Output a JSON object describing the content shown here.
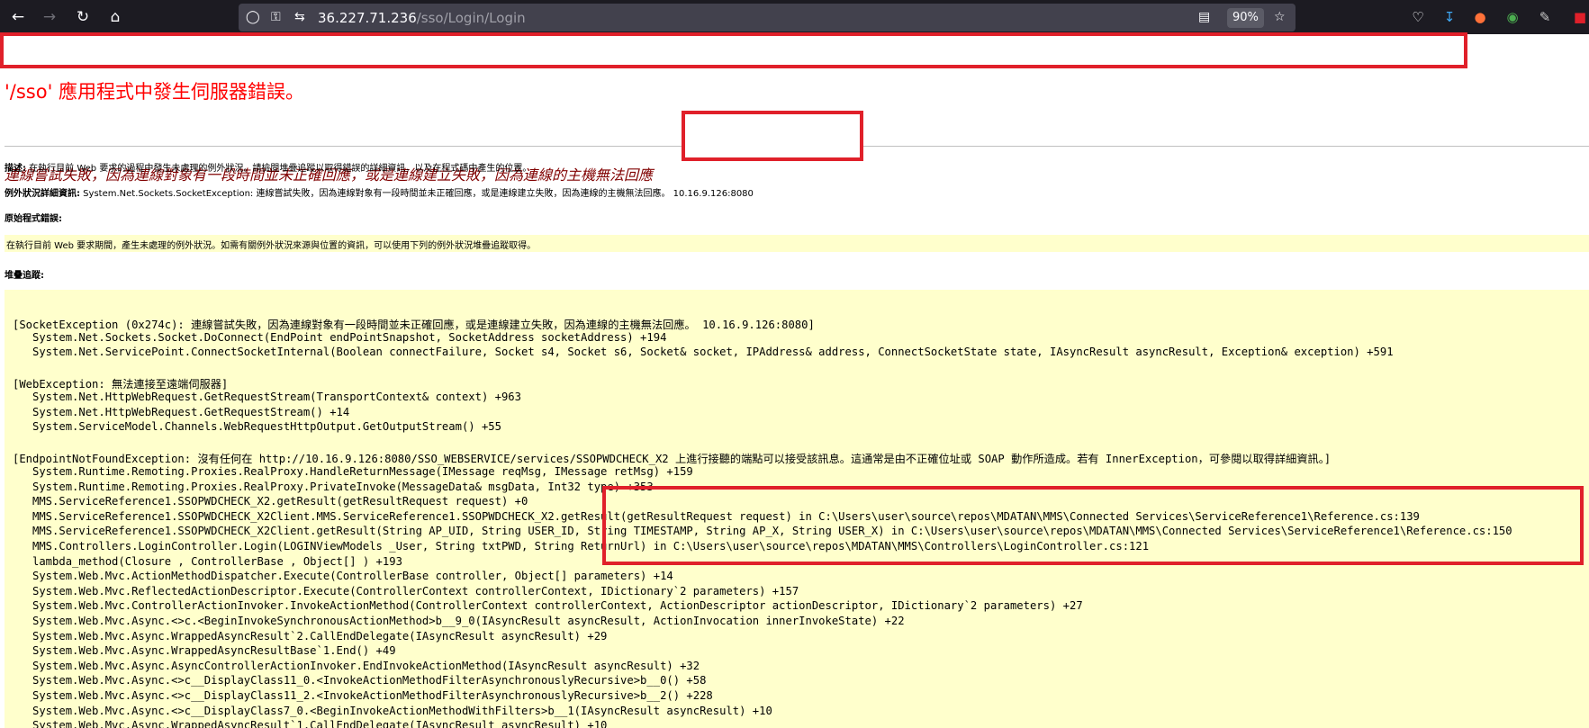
{
  "browser": {
    "url_host": "36.227.71.236",
    "url_path": "/sso/Login/Login",
    "zoom": "90%",
    "icons": [
      "back-icon",
      "forward-icon",
      "reload-icon",
      "home-icon",
      "shield-icon",
      "lock-icon",
      "permissions-icon",
      "reader-view-icon",
      "bookmark-star-icon",
      "pocket-icon",
      "download-icon",
      "extension-icon"
    ]
  },
  "page": {
    "heading": "'/sso' 應用程式中發生伺服器錯誤。",
    "subheading": "連線嘗試失敗，因為連線對象有一段時間並未正確回應，或是連線建立失敗，因為連線的主機無法回應",
    "description_label": "描述:",
    "description_text": " 在執行目前 Web 要求的過程中發生未處理的例外狀況。請檢閱堆疊追蹤以取得錯誤的詳細資訊，以及在程式碼中產生的位置。",
    "exception_label": "例外狀況詳細資訊:",
    "exception_text": " System.Net.Sockets.SocketException: 連線嘗試失敗，因為連線對象有一段時間並未正確回應，或是連線建立失敗，因為連線的主機無法回應。 10.16.9.126:8080",
    "source_error_label": "原始程式錯誤:",
    "source_error_text": "在執行目前 Web 要求期間，產生未處理的例外狀況。如需有關例外狀況來源與位置的資訊，可以使用下列的例外狀況堆疊追蹤取得。",
    "stack_trace_label": "堆疊追蹤:",
    "stack_trace": [
      "[SocketException (0x274c): 連線嘗試失敗，因為連線對象有一段時間並未正確回應，或是連線建立失敗，因為連線的主機無法回應。 10.16.9.126:8080]",
      "   System.Net.Sockets.Socket.DoConnect(EndPoint endPointSnapshot, SocketAddress socketAddress) +194",
      "   System.Net.ServicePoint.ConnectSocketInternal(Boolean connectFailure, Socket s4, Socket s6, Socket& socket, IPAddress& address, ConnectSocketState state, IAsyncResult asyncResult, Exception& exception) +591",
      "",
      "[WebException: 無法連接至遠端伺服器]",
      "   System.Net.HttpWebRequest.GetRequestStream(TransportContext& context) +963",
      "   System.Net.HttpWebRequest.GetRequestStream() +14",
      "   System.ServiceModel.Channels.WebRequestHttpOutput.GetOutputStream() +55",
      "",
      "[EndpointNotFoundException: 沒有任何在 http://10.16.9.126:8080/SSO_WEBSERVICE/services/SSOPWDCHECK_X2 上進行接聽的端點可以接受該訊息。這通常是由不正確位址或 SOAP 動作所造成。若有 InnerException，可參閱以取得詳細資訊。]",
      "   System.Runtime.Remoting.Proxies.RealProxy.HandleReturnMessage(IMessage reqMsg, IMessage retMsg) +159",
      "   System.Runtime.Remoting.Proxies.RealProxy.PrivateInvoke(MessageData& msgData, Int32 type) +353",
      "   MMS.ServiceReference1.SSOPWDCHECK_X2.getResult(getResultRequest request) +0",
      "   MMS.ServiceReference1.SSOPWDCHECK_X2Client.MMS.ServiceReference1.SSOPWDCHECK_X2.getResult(getResultRequest request) in C:\\Users\\user\\source\\repos\\MDATAN\\MMS\\Connected Services\\ServiceReference1\\Reference.cs:139",
      "   MMS.ServiceReference1.SSOPWDCHECK_X2Client.getResult(String AP_UID, String USER_ID, String TIMESTAMP, String AP_X, String USER_X) in C:\\Users\\user\\source\\repos\\MDATAN\\MMS\\Connected Services\\ServiceReference1\\Reference.cs:150",
      "   MMS.Controllers.LoginController.Login(LOGINViewModels _User, String txtPWD, String ReturnUrl) in C:\\Users\\user\\source\\repos\\MDATAN\\MMS\\Controllers\\LoginController.cs:121",
      "   lambda_method(Closure , ControllerBase , Object[] ) +193",
      "   System.Web.Mvc.ActionMethodDispatcher.Execute(ControllerBase controller, Object[] parameters) +14",
      "   System.Web.Mvc.ReflectedActionDescriptor.Execute(ControllerContext controllerContext, IDictionary`2 parameters) +157",
      "   System.Web.Mvc.ControllerActionInvoker.InvokeActionMethod(ControllerContext controllerContext, ActionDescriptor actionDescriptor, IDictionary`2 parameters) +27",
      "   System.Web.Mvc.Async.<>c.<BeginInvokeSynchronousActionMethod>b__9_0(IAsyncResult asyncResult, ActionInvocation innerInvokeState) +22",
      "   System.Web.Mvc.Async.WrappedAsyncResult`2.CallEndDelegate(IAsyncResult asyncResult) +29",
      "   System.Web.Mvc.Async.WrappedAsyncResultBase`1.End() +49",
      "   System.Web.Mvc.Async.AsyncControllerActionInvoker.EndInvokeActionMethod(IAsyncResult asyncResult) +32",
      "   System.Web.Mvc.Async.<>c__DisplayClass11_0.<InvokeActionMethodFilterAsynchronouslyRecursive>b__0() +58",
      "   System.Web.Mvc.Async.<>c__DisplayClass11_2.<InvokeActionMethodFilterAsynchronouslyRecursive>b__2() +228",
      "   System.Web.Mvc.Async.<>c__DisplayClass7_0.<BeginInvokeActionMethodWithFilters>b__1(IAsyncResult asyncResult) +10",
      "   System.Web.Mvc.Async.WrappedAsyncResult`1.CallEndDelegate(IAsyncResult asyncResult) +10"
    ]
  }
}
